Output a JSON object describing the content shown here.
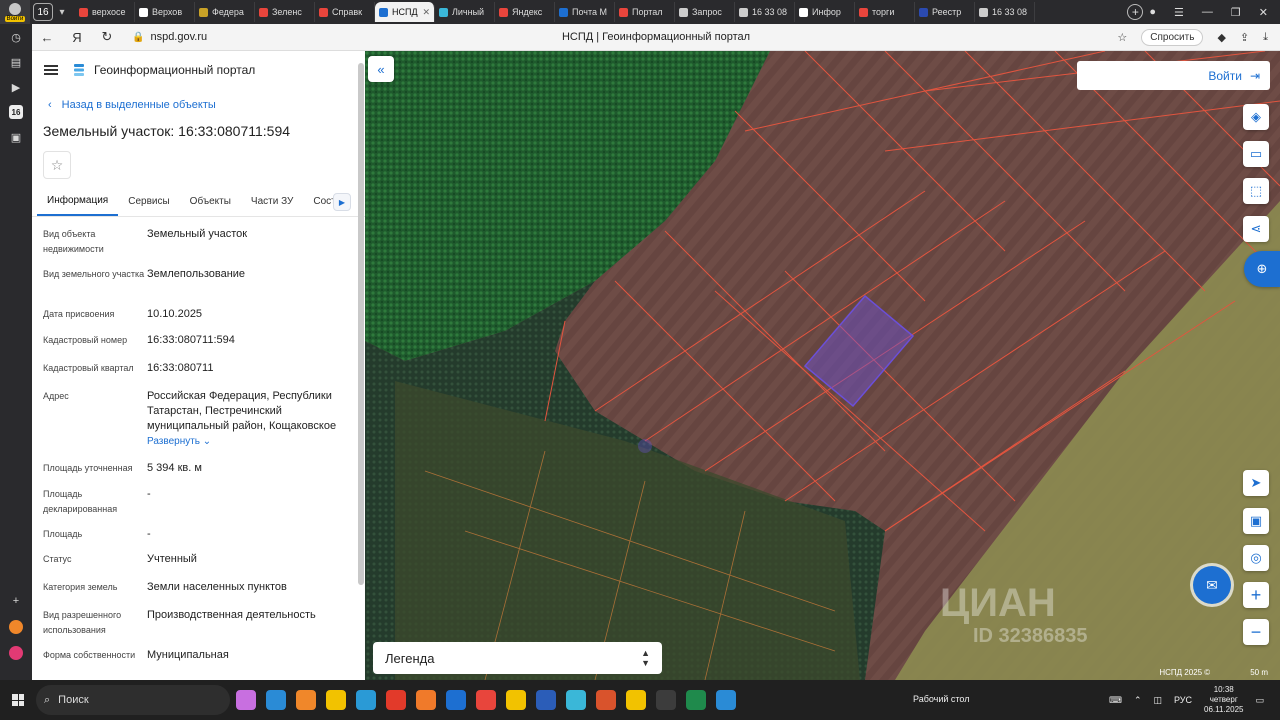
{
  "browser": {
    "profile_tag": "Войти",
    "tab_count": "16",
    "tabs": [
      {
        "label": "верхосе",
        "color": "#e8453c"
      },
      {
        "label": "Верхов",
        "color": "#ffffff"
      },
      {
        "label": "Федера",
        "color": "#c9a227"
      },
      {
        "label": "Зеленс",
        "color": "#e8453c"
      },
      {
        "label": "Справк",
        "color": "#e8453c"
      },
      {
        "label": "НСПД",
        "color": "#1d6fd1"
      },
      {
        "label": "Личный",
        "color": "#3ab7d8"
      },
      {
        "label": "Яндекс",
        "color": "#e8453c"
      },
      {
        "label": "Почта М",
        "color": "#1d6fd1"
      },
      {
        "label": "Портал",
        "color": "#e8453c"
      },
      {
        "label": "Запрос",
        "color": "#cccccc"
      },
      {
        "label": "16 33 08",
        "color": "#cccccc"
      },
      {
        "label": "Инфор",
        "color": "#ffffff"
      },
      {
        "label": "торги",
        "color": "#e8453c"
      },
      {
        "label": "Реестр",
        "color": "#2b4ab0"
      },
      {
        "label": "16 33 08",
        "color": "#cccccc"
      }
    ],
    "active_tab_index": 5,
    "url": "nspd.gov.ru",
    "page_title": "НСПД | Геоинформационный портал",
    "ask_label": "Спросить",
    "rail_badge": "16"
  },
  "sidebar": {
    "brand": "Геоинформационный портал",
    "back_link": "Назад в выделенные объекты",
    "title": "Земельный участок: 16:33:080711:594",
    "tabs": [
      "Информация",
      "Сервисы",
      "Объекты",
      "Части ЗУ",
      "Соста"
    ],
    "fields": [
      {
        "label": "Вид объекта недвижимости",
        "value": "Земельный участок"
      },
      {
        "label": "Вид земельного участка",
        "value": "Землепользование"
      },
      {
        "label": "Дата присвоения",
        "value": "10.10.2025"
      },
      {
        "label": "Кадастровый номер",
        "value": "16:33:080711:594"
      },
      {
        "label": "Кадастровый квартал",
        "value": "16:33:080711"
      },
      {
        "label": "Адрес",
        "value": "Российская Федерация, Республики Татарстан, Пестречинский муниципальный район, Кощаковское"
      },
      {
        "label": "Площадь уточненная",
        "value": "5 394 кв. м"
      },
      {
        "label": "Площадь декларированная",
        "value": "-"
      },
      {
        "label": "Площадь",
        "value": "-"
      },
      {
        "label": "Статус",
        "value": "Учтенный"
      },
      {
        "label": "Категория земель",
        "value": "Земли населенных пунктов"
      },
      {
        "label": "Вид разрешенного использования",
        "value": "Производственная деятельность"
      },
      {
        "label": "Форма собственности",
        "value": "Муниципальная"
      }
    ],
    "expand_label": "Развернуть"
  },
  "map": {
    "login_label": "Войти",
    "legend_label": "Легенда",
    "watermark": "ЦИАН",
    "watermark_id": "ID 32386835",
    "copyright": "НСПД 2025 ©",
    "scale": "50 m",
    "colors": {
      "forest": "#1a5d2c",
      "field": "#6a4a44",
      "zone": "#8a8a4c",
      "parcel_line": "#e2553f",
      "selected": "#6b4fd8"
    }
  },
  "taskbar": {
    "search_placeholder": "Поиск",
    "desktop_label": "Рабочий стол",
    "lang": "РУС",
    "time": "10:38",
    "day": "четверг",
    "date": "06.11.2025"
  }
}
